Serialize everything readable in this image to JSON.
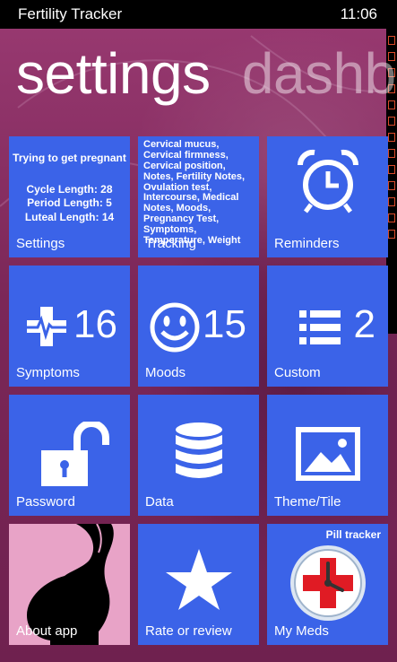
{
  "status_bar": {
    "app_title": "Fertility Tracker",
    "time": "11:06"
  },
  "hub": {
    "active_section": "settings",
    "next_section": "dashb"
  },
  "tiles": {
    "settings": {
      "label": "Settings",
      "heading": "Trying to get pregnant",
      "cycle_length": "Cycle Length: 28",
      "period_length": "Period Length: 5",
      "luteal_length": "Luteal Length: 14"
    },
    "tracking": {
      "label": "Tracking",
      "items_text": "Cervical mucus, Cervical firmness, Cervical position, Notes, Fertility Notes, Ovulation test, Intercourse, Medical Notes, Moods, Pregnancy Test, Symptoms, Temperature, Weight"
    },
    "reminders": {
      "label": "Reminders",
      "icon": "alarm-clock-icon"
    },
    "symptoms": {
      "label": "Symptoms",
      "count": "16",
      "icon": "heartbeat-cross-icon"
    },
    "moods": {
      "label": "Moods",
      "count": "15",
      "icon": "smiley-icon"
    },
    "custom": {
      "label": "Custom",
      "count": "2",
      "icon": "list-icon"
    },
    "password": {
      "label": "Password",
      "icon": "unlocked-padlock-icon"
    },
    "data": {
      "label": "Data",
      "icon": "database-icon"
    },
    "theme": {
      "label": "Theme/Tile",
      "icon": "picture-icon"
    },
    "about": {
      "label": "About app",
      "icon": "pregnant-silhouette-icon"
    },
    "rate": {
      "label": "Rate or review",
      "icon": "star-icon"
    },
    "meds": {
      "label": "My Meds",
      "subtitle": "Pill tracker",
      "icon": "medical-cross-clock-icon"
    }
  },
  "colors": {
    "tile": "#3b63e8",
    "background": "#7f2a5d",
    "about_tile": "#e8a3c7",
    "meds_cross": "#e01b24"
  }
}
